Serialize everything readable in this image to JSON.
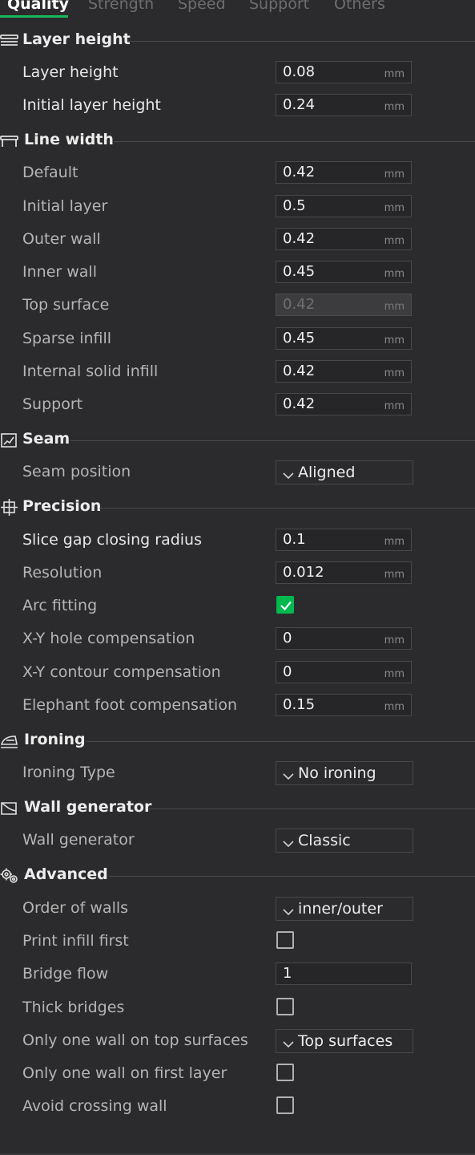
{
  "tabs": [
    "Quality",
    "Strength",
    "Speed",
    "Support",
    "Others"
  ],
  "sections": {
    "layer_height": "Layer height",
    "line_width": "Line width",
    "seam": "Seam",
    "precision": "Precision",
    "ironing": "Ironing",
    "wall_generator": "Wall generator",
    "advanced": "Advanced"
  },
  "unit": "mm",
  "rows": {
    "layer_height": {
      "label": "Layer height",
      "value": "0.08"
    },
    "initial_layer_height": {
      "label": "Initial layer height",
      "value": "0.24"
    },
    "lw_default": {
      "label": "Default",
      "value": "0.42"
    },
    "lw_initial_layer": {
      "label": "Initial layer",
      "value": "0.5"
    },
    "lw_outer_wall": {
      "label": "Outer wall",
      "value": "0.42"
    },
    "lw_inner_wall": {
      "label": "Inner wall",
      "value": "0.45"
    },
    "lw_top_surface": {
      "label": "Top surface",
      "value": "0.42"
    },
    "lw_sparse_infill": {
      "label": "Sparse infill",
      "value": "0.45"
    },
    "lw_internal_solid_infill": {
      "label": "Internal solid infill",
      "value": "0.42"
    },
    "lw_support": {
      "label": "Support",
      "value": "0.42"
    },
    "seam_position": {
      "label": "Seam position",
      "value": "Aligned"
    },
    "slice_gap_closing_radius": {
      "label": "Slice gap closing radius",
      "value": "0.1"
    },
    "resolution": {
      "label": "Resolution",
      "value": "0.012"
    },
    "arc_fitting": {
      "label": "Arc fitting",
      "checked": true
    },
    "xy_hole_comp": {
      "label": "X-Y hole compensation",
      "value": "0"
    },
    "xy_contour_comp": {
      "label": "X-Y contour compensation",
      "value": "0"
    },
    "elephant_foot_comp": {
      "label": "Elephant foot compensation",
      "value": "0.15"
    },
    "ironing_type": {
      "label": "Ironing Type",
      "value": "No ironing"
    },
    "wall_generator": {
      "label": "Wall generator",
      "value": "Classic"
    },
    "order_of_walls": {
      "label": "Order of walls",
      "value": "inner/outer"
    },
    "print_infill_first": {
      "label": "Print infill first",
      "checked": false
    },
    "bridge_flow": {
      "label": "Bridge flow",
      "value": "1"
    },
    "thick_bridges": {
      "label": "Thick bridges",
      "checked": false
    },
    "only_one_wall_top": {
      "label": "Only one wall on top surfaces",
      "value": "Top surfaces"
    },
    "only_one_wall_first": {
      "label": "Only one wall on first layer",
      "checked": false
    },
    "avoid_crossing_wall": {
      "label": "Avoid crossing wall",
      "checked": false
    }
  },
  "colors": {
    "background": "#2b2b2d",
    "accent": "#18b85a",
    "checkbox_checked": "#00b94e"
  },
  "icons": {
    "layer_height": "layers-icon",
    "line_width": "line-width-icon",
    "seam": "seam-icon",
    "precision": "precision-icon",
    "ironing": "iron-icon",
    "wall_generator": "wall-generator-icon",
    "advanced": "gears-icon",
    "dropdown": "chevron-down-icon",
    "check": "check-icon"
  }
}
